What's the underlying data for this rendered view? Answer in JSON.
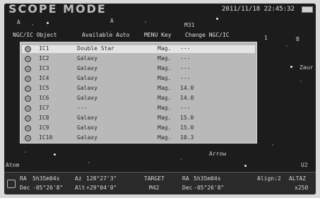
{
  "header": {
    "mode_title": "SCOPE MODE",
    "datetime": "2011/11/18 22:45:32"
  },
  "sky_labels": {
    "a": "A",
    "a2": "A",
    "m31": "M31",
    "b": "B",
    "zaur": "Zaur",
    "arrow": "Arrow",
    "atom": "Atom",
    "u2": "U2",
    "one": "1"
  },
  "hint_bar": {
    "title": "NGC/IC Object",
    "available": "Available Auto",
    "menu_key": "MENU Key",
    "change": "Change NGC/IC"
  },
  "list": {
    "rows": [
      {
        "id": "IC1",
        "type": "Double Star",
        "mag_label": "Mag.",
        "mag": "---",
        "selected": true
      },
      {
        "id": "IC2",
        "type": "Galaxy",
        "mag_label": "Mag.",
        "mag": "---",
        "selected": false
      },
      {
        "id": "IC3",
        "type": "Galaxy",
        "mag_label": "Mag.",
        "mag": "---",
        "selected": false
      },
      {
        "id": "IC4",
        "type": "Galaxy",
        "mag_label": "Mag.",
        "mag": "---",
        "selected": false
      },
      {
        "id": "IC5",
        "type": "Galaxy",
        "mag_label": "Mag.",
        "mag": "14.0",
        "selected": false
      },
      {
        "id": "IC6",
        "type": "Galaxy",
        "mag_label": "Mag.",
        "mag": "14.0",
        "selected": false
      },
      {
        "id": "IC7",
        "type": "---",
        "mag_label": "Mag.",
        "mag": "---",
        "selected": false
      },
      {
        "id": "IC8",
        "type": "Galaxy",
        "mag_label": "Mag.",
        "mag": "15.0",
        "selected": false
      },
      {
        "id": "IC9",
        "type": "Galaxy",
        "mag_label": "Mag.",
        "mag": "15.0",
        "selected": false
      },
      {
        "id": "IC10",
        "type": "Galaxy",
        "mag_label": "Mag.",
        "mag": "10.3",
        "selected": false
      }
    ]
  },
  "status": {
    "ra_label": "RA",
    "ra_value": "5h35m04s",
    "az_label": "Az",
    "az_value": "128°27'3\"",
    "dec_label": "Dec",
    "dec_value": "-05°26'8\"",
    "alt_label": "Alt",
    "alt_value": "+29°04'0\"",
    "target_label": "TARGET",
    "target_value": "M42",
    "t_ra_label": "RA",
    "t_ra_value": "5h35m04s",
    "t_dec_label": "Dec",
    "t_dec_value": "-05°26'8\"",
    "align": "Align:2",
    "altaz": "ALTAZ",
    "zoom": "x250"
  }
}
